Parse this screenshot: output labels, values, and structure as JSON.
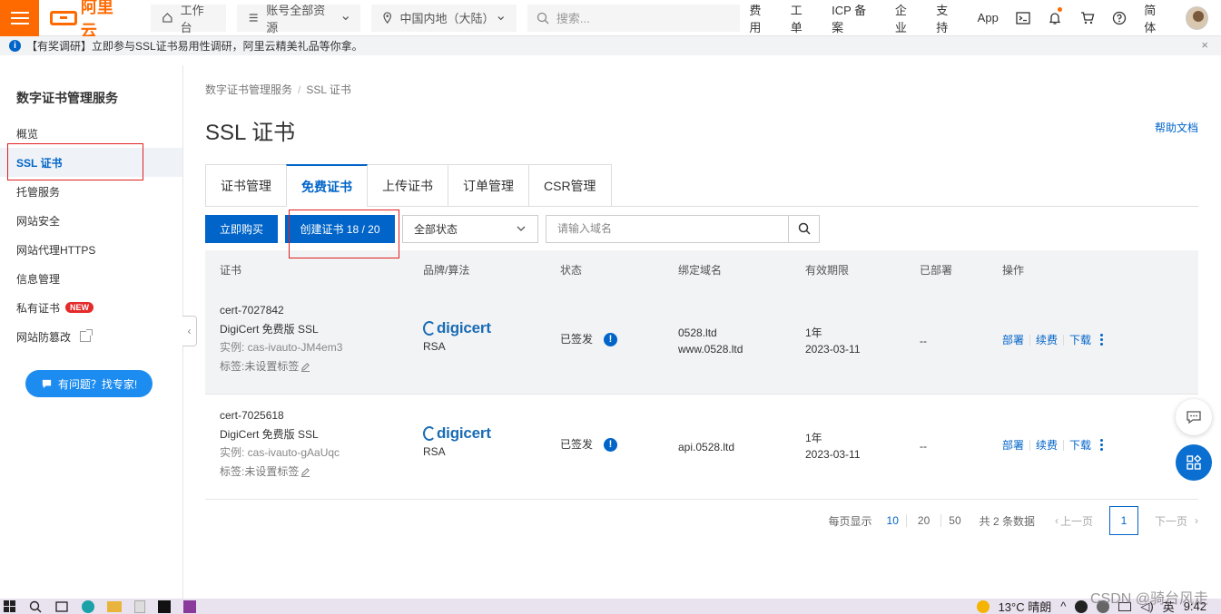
{
  "topbar": {
    "logo_text": "阿里云",
    "workbench": "工作台",
    "account_scope": "账号全部资源",
    "region": "中国内地（大陆）",
    "search_placeholder": "搜索...",
    "links": [
      "费用",
      "工单",
      "ICP 备案",
      "企业",
      "支持",
      "App"
    ],
    "language": "简体"
  },
  "notice": {
    "text": "【有奖调研】立即参与SSL证书易用性调研，阿里云精美礼品等你拿。",
    "close": "×"
  },
  "sidebar": {
    "title": "数字证书管理服务",
    "items": [
      {
        "label": "概览"
      },
      {
        "label": "SSL 证书"
      },
      {
        "label": "托管服务"
      },
      {
        "label": "网站安全"
      },
      {
        "label": "网站代理HTTPS"
      },
      {
        "label": "信息管理"
      },
      {
        "label": "私有证书",
        "badge": "NEW"
      },
      {
        "label": "网站防篡改"
      }
    ],
    "expert_button": "有问题？找专家!"
  },
  "main": {
    "breadcrumb": [
      "数字证书管理服务",
      "SSL 证书"
    ],
    "breadcrumb_sep": "/",
    "title": "SSL 证书",
    "help_link": "帮助文档",
    "tabs": [
      "证书管理",
      "免费证书",
      "上传证书",
      "订单管理",
      "CSR管理"
    ],
    "active_tab": "免费证书",
    "toolbar": {
      "buy_button": "立即购买",
      "create_button": "创建证书 18 / 20",
      "status_select": "全部状态",
      "domain_placeholder": "请输入域名"
    },
    "table": {
      "columns": [
        "证书",
        "品牌/算法",
        "状态",
        "绑定域名",
        "有效期限",
        "已部署",
        "操作"
      ],
      "rows": [
        {
          "id": "cert-7027842",
          "name": "DigiCert 免费版 SSL",
          "instance": "实例: cas-ivauto-JM4em3",
          "tag": "标签:未设置标签",
          "brand": "digicert",
          "algorithm": "RSA",
          "status": "已签发",
          "domain1": "0528.ltd",
          "domain2": "www.0528.ltd",
          "validity": "1年",
          "date": "2023-03-11",
          "deployed": "--",
          "actions": [
            "部署",
            "续费",
            "下载"
          ]
        },
        {
          "id": "cert-7025618",
          "name": "DigiCert 免费版 SSL",
          "instance": "实例: cas-ivauto-gAaUqc",
          "tag": "标签:未设置标签",
          "brand": "digicert",
          "algorithm": "RSA",
          "status": "已签发",
          "domain1": "api.0528.ltd",
          "validity": "1年",
          "date": "2023-03-11",
          "deployed": "--",
          "actions": [
            "部署",
            "续费",
            "下载"
          ]
        }
      ]
    },
    "pagination": {
      "per_page_label": "每页显示",
      "sizes": [
        "10",
        "20",
        "50"
      ],
      "total": "共 2 条数据",
      "prev": "上一页",
      "current": "1",
      "next": "下一页"
    }
  },
  "taskbar": {
    "weather": "13°C 晴朗",
    "input_method": "英",
    "time": "9:42"
  },
  "watermark": "CSDN @骑台风走",
  "colors": {
    "brand_orange": "#ff6a00",
    "primary_blue": "#0064c8",
    "highlight_red": "#e02020",
    "new_badge": "#e42a2a"
  }
}
